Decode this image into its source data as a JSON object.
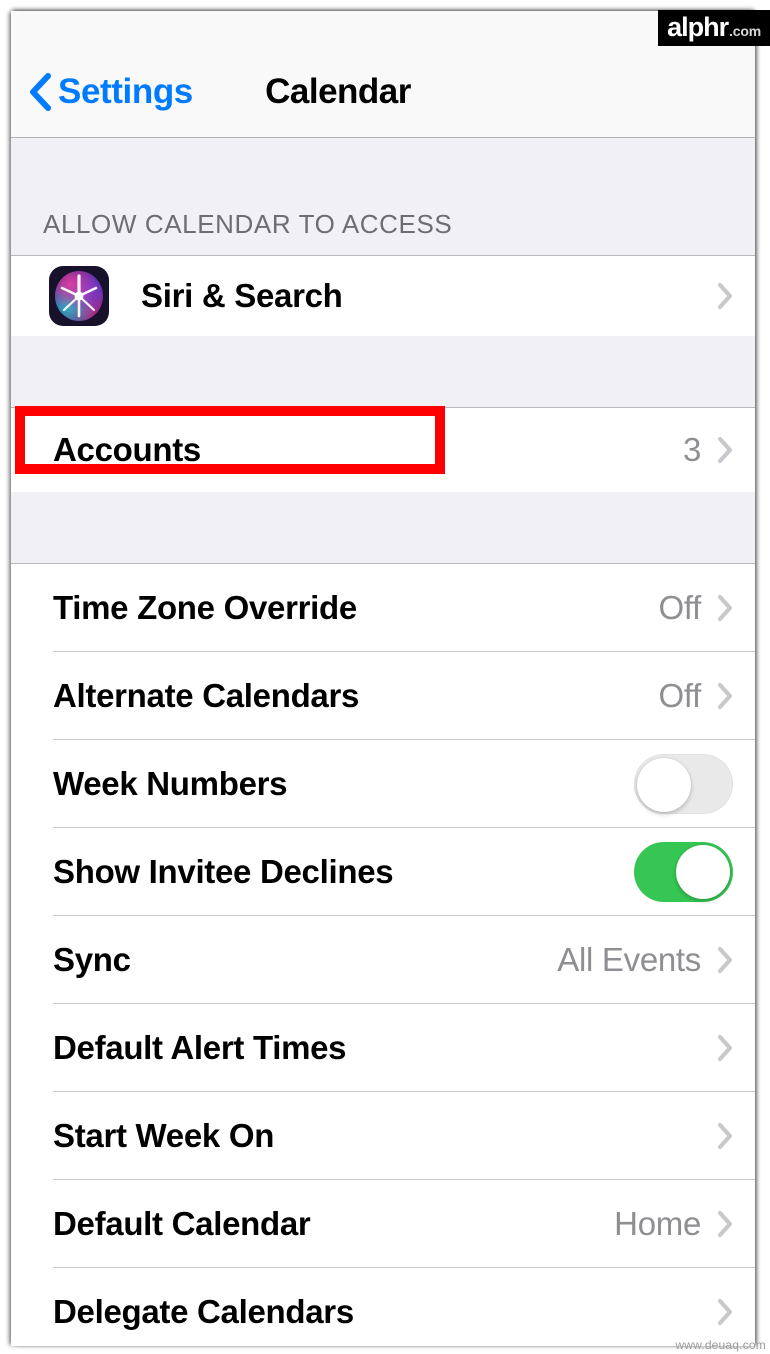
{
  "colors": {
    "accent_blue": "#007AFF",
    "toggle_on_green": "#35C653",
    "chevron_grey": "#C7C7CC",
    "value_grey": "#8E8E93",
    "group_background": "#F1F1F5",
    "annotation_red": "#FF0000"
  },
  "nav": {
    "back_label": "Settings",
    "title": "Calendar",
    "back_icon": "chevron-left-icon"
  },
  "sections": [
    {
      "header": "ALLOW CALENDAR TO ACCESS",
      "rows": [
        {
          "title": "Siri & Search",
          "value": "",
          "icon": "siri-app-icon",
          "accessory": "chevron-right-icon"
        }
      ]
    },
    {
      "header": "",
      "rows": [
        {
          "title": "Accounts",
          "value": "3",
          "icon": "",
          "accessory": "chevron-right-icon"
        }
      ]
    },
    {
      "header": "",
      "rows": [
        {
          "title": "Time Zone Override",
          "value": "Off",
          "icon": "",
          "accessory": "chevron-right-icon"
        },
        {
          "title": "Alternate Calendars",
          "value": "Off",
          "icon": "",
          "accessory": "chevron-right-icon"
        },
        {
          "title": "Week Numbers",
          "value": "",
          "icon": "",
          "accessory": "toggle-off"
        },
        {
          "title": "Show Invitee Declines",
          "value": "",
          "icon": "",
          "accessory": "toggle-on"
        },
        {
          "title": "Sync",
          "value": "All Events",
          "icon": "",
          "accessory": "chevron-right-icon"
        },
        {
          "title": "Default Alert Times",
          "value": "",
          "icon": "",
          "accessory": "chevron-right-icon"
        },
        {
          "title": "Start Week On",
          "value": "",
          "icon": "",
          "accessory": "chevron-right-icon"
        },
        {
          "title": "Default Calendar",
          "value": "Home",
          "icon": "",
          "accessory": "chevron-right-icon"
        },
        {
          "title": "Delegate Calendars",
          "value": "",
          "icon": "",
          "accessory": "chevron-right-icon"
        }
      ]
    }
  ],
  "annotation": {
    "target_row": "Accounts",
    "shape": "rectangle",
    "color": "#FF0000"
  },
  "watermarks": {
    "top_right_name": "alphr",
    "top_right_tld": ".com",
    "bottom_right": "www.deuaq.com"
  }
}
